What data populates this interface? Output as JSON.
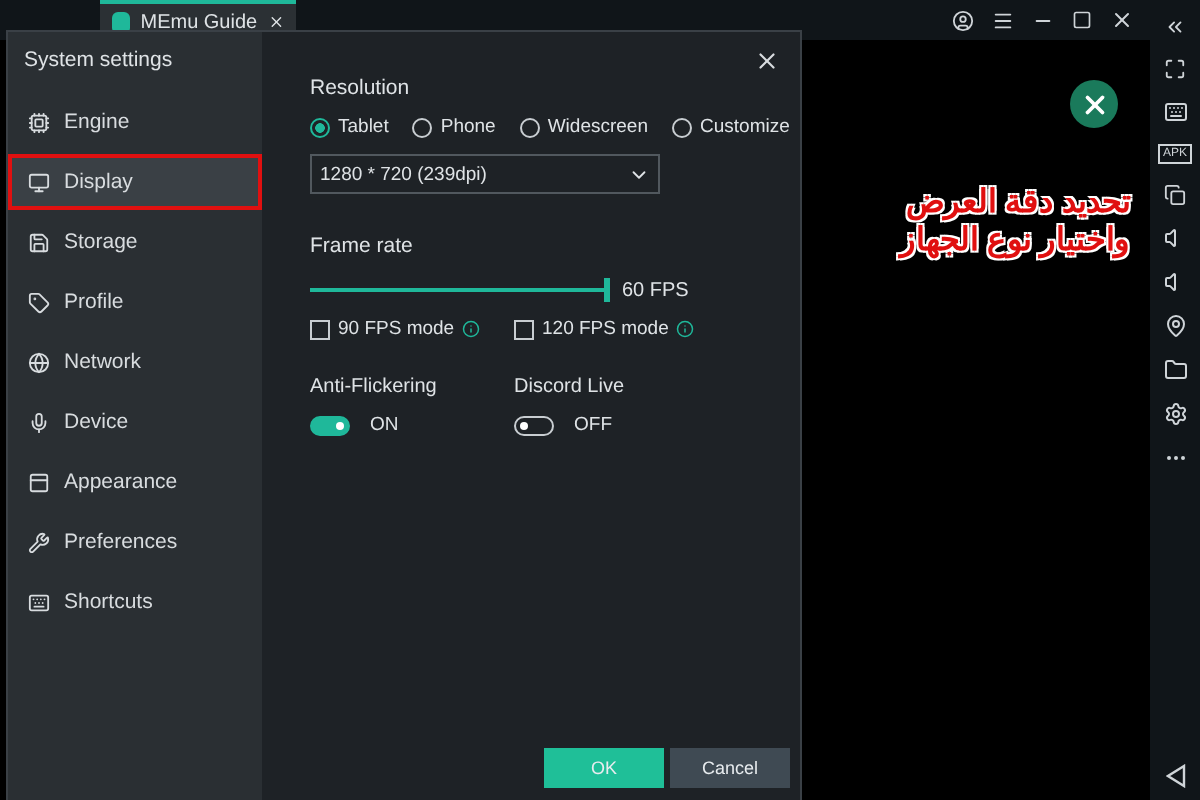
{
  "app_tab": {
    "title": "MEmu Guide"
  },
  "settings": {
    "title": "System settings",
    "nav": [
      {
        "label": "Engine",
        "selected": false,
        "highlighted": false
      },
      {
        "label": "Display",
        "selected": true,
        "highlighted": true
      },
      {
        "label": "Storage",
        "selected": false,
        "highlighted": false
      },
      {
        "label": "Profile",
        "selected": false,
        "highlighted": false
      },
      {
        "label": "Network",
        "selected": false,
        "highlighted": false
      },
      {
        "label": "Device",
        "selected": false,
        "highlighted": false
      },
      {
        "label": "Appearance",
        "selected": false,
        "highlighted": false
      },
      {
        "label": "Preferences",
        "selected": false,
        "highlighted": false
      },
      {
        "label": "Shortcuts",
        "selected": false,
        "highlighted": false
      }
    ],
    "resolution": {
      "label": "Resolution",
      "options": [
        {
          "label": "Tablet",
          "selected": true
        },
        {
          "label": "Phone",
          "selected": false
        },
        {
          "label": "Widescreen",
          "selected": false
        },
        {
          "label": "Customize",
          "selected": false
        }
      ],
      "value": "1280 * 720 (239dpi)"
    },
    "frame_rate": {
      "label": "Frame rate",
      "level": 1,
      "reading": "60 FPS",
      "modes": [
        {
          "label": "90 FPS mode",
          "checked": false
        },
        {
          "label": "120 FPS mode",
          "checked": false
        }
      ]
    },
    "toggles": [
      {
        "label": "Anti-Flickering",
        "on": true,
        "state_text": "ON"
      },
      {
        "label": "Discord Live",
        "on": false,
        "state_text": "OFF"
      }
    ],
    "buttons": [
      {
        "label": "OK",
        "kind": "primary"
      },
      {
        "label": "Cancel",
        "kind": "secondary"
      }
    ]
  },
  "side_toolbar": {
    "apk_label": "APK"
  },
  "annotation": {
    "lines": [
      "تحديد دقة العرض",
      "واختيار نوع الجهاز"
    ]
  }
}
